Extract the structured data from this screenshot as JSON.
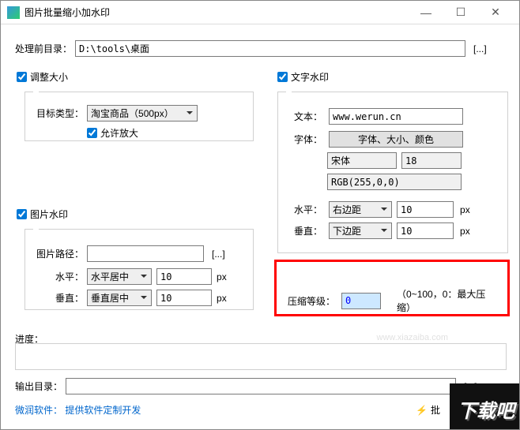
{
  "title": "图片批量缩小加水印",
  "dir_label": "处理前目录：",
  "dir_value": "D:\\tools\\桌面",
  "browse": "[...]",
  "resize": {
    "check": "调整大小",
    "type_label": "目标类型：",
    "type_value": "淘宝商品（500px）",
    "allow_enlarge": "允许放大"
  },
  "img_wm": {
    "check": "图片水印",
    "path_label": "图片路径：",
    "path_value": "",
    "h_label": "水平：",
    "h_value": "水平居中",
    "h_off": "10",
    "v_label": "垂直：",
    "v_value": "垂直居中",
    "v_off": "10",
    "px": "px"
  },
  "txt_wm": {
    "check": "文字水印",
    "text_label": "文本：",
    "text_value": "www.werun.cn",
    "font_label": "字体：",
    "font_btn": "字体、大小、颜色",
    "font_name": "宋体",
    "font_size": "18",
    "font_color": "RGB(255,0,0)",
    "h_label": "水平：",
    "h_value": "右边距",
    "h_off": "10",
    "v_label": "垂直：",
    "v_value": "下边距",
    "v_off": "10",
    "px": "px"
  },
  "comp": {
    "label": "压缩等级：",
    "value": "0",
    "hint": "（0~100，0：最大压缩）"
  },
  "progress_label": "进度：",
  "out_label": "输出目录：",
  "out_value": "",
  "footer_brand": "微润软件：",
  "footer_link": "提供软件定制开发",
  "batch": "批",
  "site_wm": "www.xiazaiba.com",
  "logo": "下载吧"
}
